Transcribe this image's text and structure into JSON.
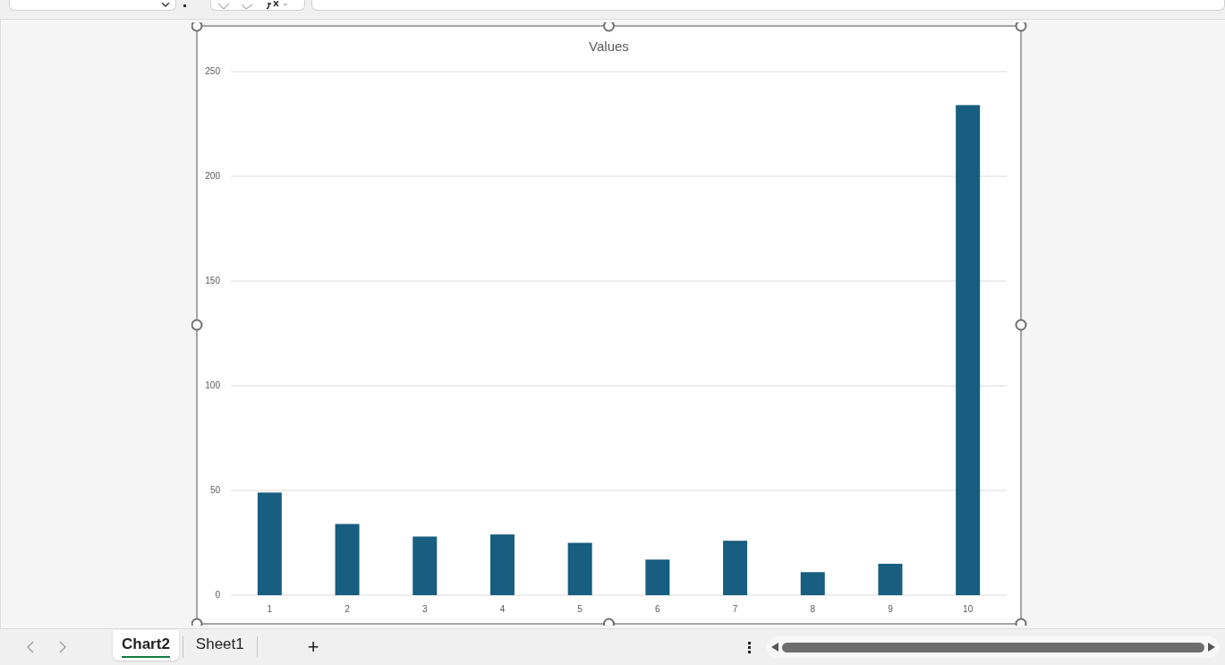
{
  "chart": {
    "chart_data": {
      "type": "bar",
      "title": "Values",
      "categories": [
        "1",
        "2",
        "3",
        "4",
        "5",
        "6",
        "7",
        "8",
        "9",
        "10"
      ],
      "series": [
        {
          "color": "#175e80",
          "values": [
            49,
            34,
            28,
            29,
            25,
            17,
            26,
            11,
            15,
            234
          ]
        }
      ],
      "ylim": [
        0,
        250
      ],
      "grid": true,
      "yticks": [
        0,
        50,
        100,
        150,
        200,
        250
      ]
    }
  },
  "sheet_tabs": [
    {
      "label": "Chart2",
      "selected": true
    },
    {
      "label": "Sheet1",
      "selected": false
    }
  ],
  "add_sheet": "+"
}
